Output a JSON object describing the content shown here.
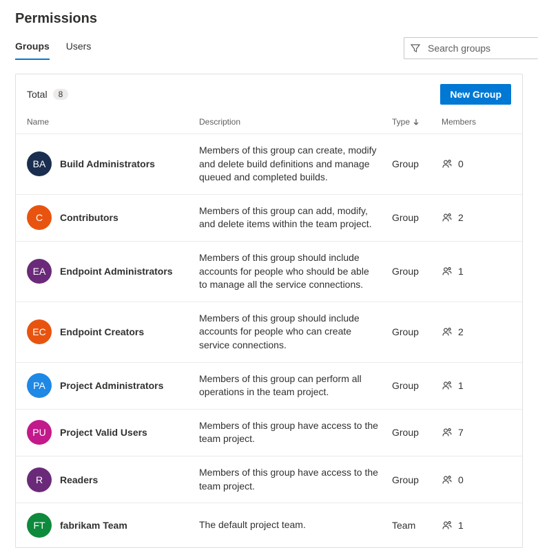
{
  "header": {
    "title": "Permissions",
    "tabs": [
      {
        "label": "Groups",
        "active": true
      },
      {
        "label": "Users",
        "active": false
      }
    ],
    "search_placeholder": "Search groups"
  },
  "toolbar": {
    "total_label": "Total",
    "total_count": "8",
    "new_group_label": "New Group"
  },
  "columns": {
    "name": "Name",
    "description": "Description",
    "type": "Type",
    "members": "Members"
  },
  "rows": [
    {
      "initials": "BA",
      "color": "#1A2E4F",
      "name": "Build Administrators",
      "description": "Members of this group can create, modify and delete build definitions and manage queued and completed builds.",
      "type": "Group",
      "members": "0"
    },
    {
      "initials": "C",
      "color": "#E8540F",
      "name": "Contributors",
      "description": "Members of this group can add, modify, and delete items within the team project.",
      "type": "Group",
      "members": "2"
    },
    {
      "initials": "EA",
      "color": "#6B2A79",
      "name": "Endpoint Administrators",
      "description": "Members of this group should include accounts for people who should be able to manage all the service connections.",
      "type": "Group",
      "members": "1"
    },
    {
      "initials": "EC",
      "color": "#E8540F",
      "name": "Endpoint Creators",
      "description": "Members of this group should include accounts for people who can create service connections.",
      "type": "Group",
      "members": "2"
    },
    {
      "initials": "PA",
      "color": "#1E88E5",
      "name": "Project Administrators",
      "description": "Members of this group can perform all operations in the team project.",
      "type": "Group",
      "members": "1"
    },
    {
      "initials": "PU",
      "color": "#C2198B",
      "name": "Project Valid Users",
      "description": "Members of this group have access to the team project.",
      "type": "Group",
      "members": "7"
    },
    {
      "initials": "R",
      "color": "#6B2A79",
      "name": "Readers",
      "description": "Members of this group have access to the team project.",
      "type": "Group",
      "members": "0"
    },
    {
      "initials": "FT",
      "color": "#0E8A3C",
      "name": "fabrikam Team",
      "description": "The default project team.",
      "type": "Team",
      "members": "1"
    }
  ]
}
